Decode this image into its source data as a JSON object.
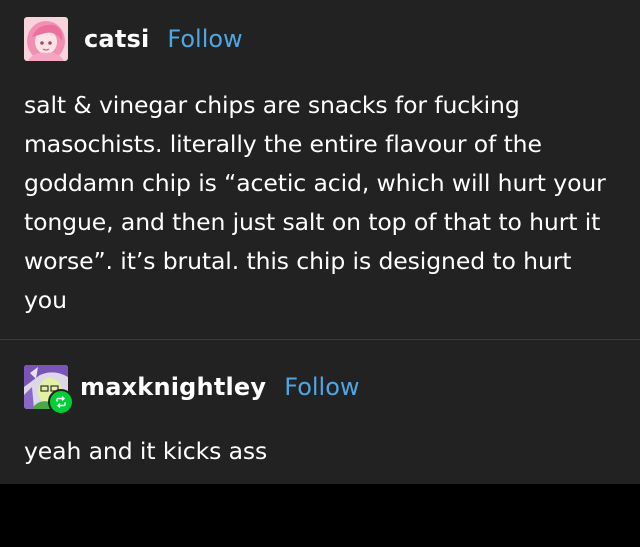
{
  "posts": [
    {
      "username": "catsi",
      "follow_label": "Follow",
      "avatar_icon": "pink-hair-character-avatar",
      "body": "salt & vinegar chips are snacks for fucking masochists. literally the entire flavour of the goddamn chip is “acetic acid, which will hurt your tongue, and then just salt on top of that to hurt it worse”. it’s brutal. this chip is designed to hurt you"
    },
    {
      "username": "maxknightley",
      "follow_label": "Follow",
      "avatar_icon": "purple-hair-character-avatar",
      "badge_icon": "reblog-icon",
      "body": "yeah and it kicks ass"
    }
  ],
  "colors": {
    "background": "#222222",
    "outer": "#000000",
    "text": "#ffffff",
    "follow": "#4ea6e3",
    "reblog_badge": "#00cf35"
  }
}
